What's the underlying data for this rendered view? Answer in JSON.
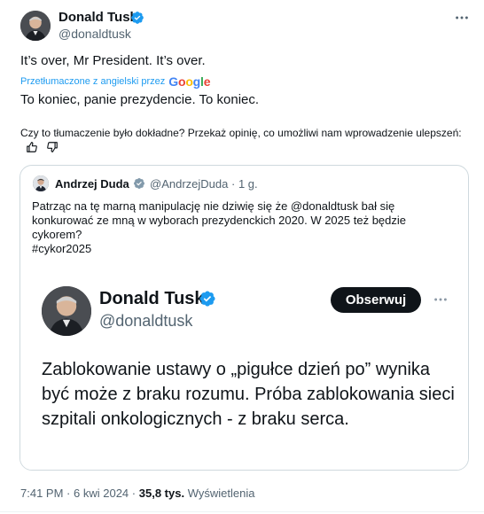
{
  "tweet": {
    "author_name": "Donald Tusk",
    "author_handle": "@donaldtusk",
    "text": "It’s over, Mr President. It’s over.",
    "translated_by": "Przetłumaczone z angielski przez",
    "google_letters": [
      "G",
      "o",
      "o",
      "g",
      "l",
      "e"
    ],
    "google_colors": [
      "#4285f4",
      "#ea4335",
      "#fbbc05",
      "#4285f4",
      "#34a853",
      "#ea4335"
    ],
    "translated_text": "To koniec, panie prezydencie. To koniec.",
    "feedback_text": "Czy to tłumaczenie było dokładne? Przekaż opinię, co umożliwi nam wprowadzenie ulepszeń:",
    "more_icon": "more-horizontal-icon",
    "verified_color": "#1d9bf0"
  },
  "quote": {
    "author_name": "Andrzej Duda",
    "author_handle": "@AndrzejDuda",
    "separator": "·",
    "age": "1 g.",
    "text": "Patrząc na tę marną manipulację nie dziwię się że @donaldtusk bał się konkurować ze mną w wyborach prezydenckich 2020. W 2025 też będzie cykorem?\n#cykor2025",
    "image": {
      "author_name": "Donald Tusk",
      "author_handle": "@donaldtusk",
      "follow_label": "Obserwuj",
      "text": "Zablokowanie ustawy o „pigułce dzień po” wynika być może z braku rozumu. Próba zablokowania sieci szpitali onkologicznych -  z braku serca."
    }
  },
  "meta": {
    "time": "7:41 PM",
    "dot1": "·",
    "date": "6 kwi 2024",
    "dot2": "·",
    "views_count": "35,8 tys.",
    "views_label": "Wyświetlenia"
  }
}
